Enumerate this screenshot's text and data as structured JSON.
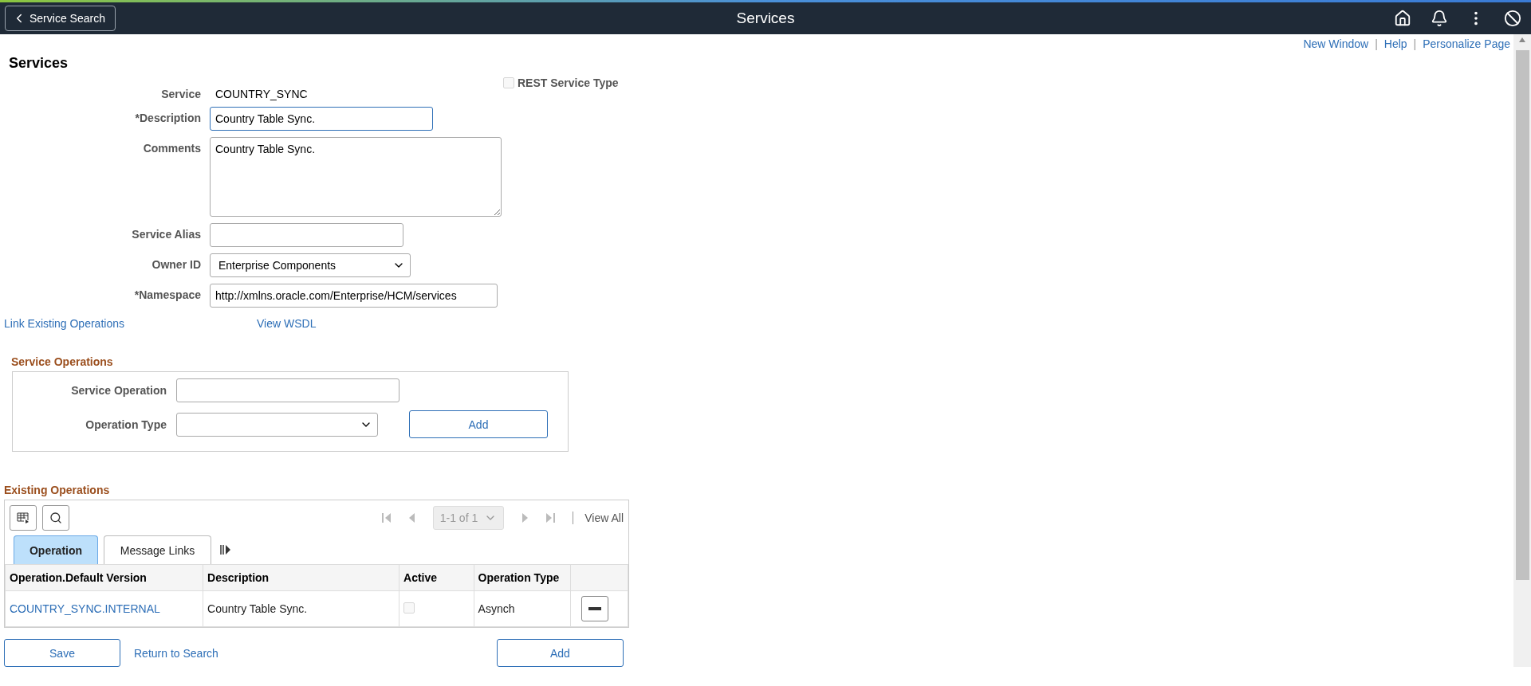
{
  "header": {
    "back_button": "Service Search",
    "title": "Services"
  },
  "top_links": [
    {
      "label": "New Window",
      "separator": "|"
    },
    {
      "label": "Help",
      "separator": "|"
    },
    {
      "label": "Personalize Page"
    }
  ],
  "page_title": "Services",
  "form": {
    "service": {
      "label": "Service",
      "value": "COUNTRY_SYNC"
    },
    "rest_service_type": {
      "label": "REST Service Type",
      "checked": false,
      "disabled": true
    },
    "description": {
      "label": "*Description",
      "value": "Country Table Sync."
    },
    "comments": {
      "label": "Comments",
      "value": "Country Table Sync."
    },
    "service_alias": {
      "label": "Service Alias"
    },
    "owner_id": {
      "label": "Owner ID",
      "value": "Enterprise Components"
    },
    "namespace": {
      "label": "*Namespace",
      "value": "http://xmlns.oracle.com/Enterprise/HCM/services"
    }
  },
  "links": [
    "Link Existing Operations",
    "View WSDL"
  ],
  "service_operations": {
    "title": "Service Operations",
    "service_operation": {
      "label": "Service Operation"
    },
    "operation_type": {
      "label": "Operation Type"
    },
    "add_button": "Add"
  },
  "existing_operations": {
    "title": "Existing Operations",
    "pager": "1-1 of 1",
    "view_all": "View All",
    "tabs": [
      {
        "label": "Operation",
        "selected": true
      },
      {
        "label": "Message Links",
        "selected": false
      }
    ],
    "columns": [
      "Operation.Default Version",
      "Description",
      "Active",
      "Operation Type"
    ],
    "rows": [
      {
        "operation": "COUNTRY_SYNC.INTERNAL",
        "description": "Country Table Sync.",
        "active": false,
        "operation_type": "Asynch"
      }
    ]
  },
  "buttons": {
    "save": "Save",
    "return_to_search": "Return to Search",
    "add": "Add"
  }
}
